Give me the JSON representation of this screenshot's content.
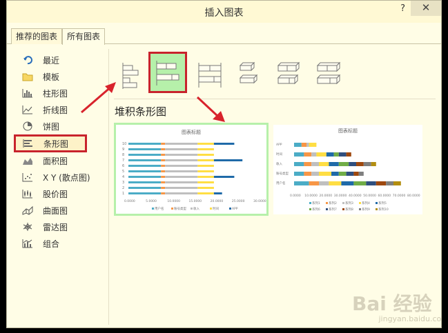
{
  "window": {
    "title": "插入图表",
    "help": "?",
    "close": "✕"
  },
  "tabs": [
    {
      "label": "推荐的图表"
    },
    {
      "label": "所有图表"
    }
  ],
  "sidebar": {
    "items": [
      {
        "label": "最近",
        "icon": "undo-icon"
      },
      {
        "label": "模板",
        "icon": "folder-icon"
      },
      {
        "label": "柱形图",
        "icon": "column-chart-icon"
      },
      {
        "label": "折线图",
        "icon": "line-chart-icon"
      },
      {
        "label": "饼图",
        "icon": "pie-chart-icon"
      },
      {
        "label": "条形图",
        "icon": "bar-chart-icon",
        "selected": true
      },
      {
        "label": "面积图",
        "icon": "area-chart-icon"
      },
      {
        "label": "X Y (散点图)",
        "icon": "scatter-chart-icon"
      },
      {
        "label": "股价图",
        "icon": "stock-chart-icon"
      },
      {
        "label": "曲面图",
        "icon": "surface-chart-icon"
      },
      {
        "label": "雷达图",
        "icon": "radar-chart-icon"
      },
      {
        "label": "组合",
        "icon": "combo-chart-icon"
      }
    ]
  },
  "subtypes": [
    "clustered-bar",
    "stacked-bar",
    "100-stacked-bar",
    "3d-clustered-bar",
    "3d-stacked-bar",
    "3d-100-stacked-bar"
  ],
  "selected_subtype_label": "堆积条形图",
  "preview1": {
    "title": "图表标题",
    "xticks": [
      "0.0000",
      "5.0000",
      "10.0000",
      "15.0000",
      "20.0000",
      "25.0000",
      "30.0000"
    ],
    "yticks": [
      "1",
      "2",
      "3",
      "4",
      "5",
      "6",
      "7",
      "8",
      "9",
      "10"
    ],
    "legend": [
      "用户名",
      "账号类型",
      "收入",
      "时间",
      "APP"
    ]
  },
  "preview2": {
    "title": "图表标题",
    "xticks": [
      "0.0000",
      "10.0000",
      "20.0000",
      "30.0000",
      "40.0000",
      "50.0000",
      "60.0000",
      "70.0000",
      "80.0000"
    ],
    "yticks": [
      "APP",
      "时间",
      "收入",
      "账号类型",
      "用户名"
    ],
    "legend": [
      "系列1",
      "系列2",
      "系列3",
      "系列4",
      "系列5",
      "系列6",
      "系列7",
      "系列8",
      "系列9",
      "系列10"
    ]
  },
  "watermark": {
    "main": "Bai 经验",
    "sub": "jingyan.baidu.com"
  },
  "colors": {
    "accent_red": "#c8232c",
    "selected_green": "#b6f0aa",
    "s1": "#4bacc6",
    "s2": "#f79646",
    "s3": "#bfbfbf",
    "s4": "#ffde43",
    "s5": "#1f6aa8"
  }
}
